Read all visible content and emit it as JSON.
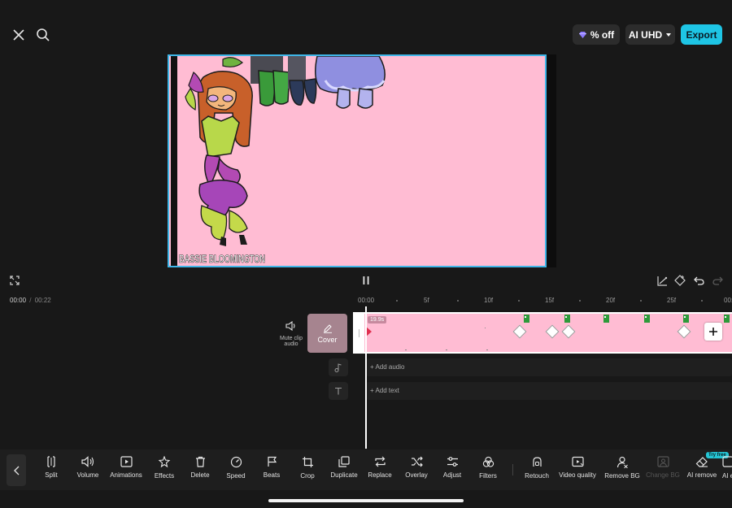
{
  "header": {
    "close_icon": "close-icon",
    "search_icon": "search-icon",
    "promo_label": "% off",
    "quality_label": "AI UHD",
    "export_label": "Export",
    "accent_color": "#1ec5e5"
  },
  "preview": {
    "watermark_text": "BASSIE BLOOMINGTON",
    "background_color": "#ffbcd3"
  },
  "playback": {
    "current_time": "00:00",
    "separator": "/",
    "total_time": "00:22"
  },
  "ruler": {
    "labels": [
      "00:00",
      "5f",
      "10f",
      "15f",
      "20f",
      "25f",
      "00:0"
    ]
  },
  "tracks": {
    "mute_label": "Mute clip audio",
    "cover_label": "Cover",
    "clip_duration": "19.9s",
    "add_audio_label": "Add audio",
    "add_text_label": "Add text"
  },
  "toolbar": {
    "items": [
      {
        "label": "Split"
      },
      {
        "label": "Volume"
      },
      {
        "label": "Animations"
      },
      {
        "label": "Effects"
      },
      {
        "label": "Delete"
      },
      {
        "label": "Speed"
      },
      {
        "label": "Beats"
      },
      {
        "label": "Crop"
      },
      {
        "label": "Duplicate"
      },
      {
        "label": "Replace"
      },
      {
        "label": "Overlay"
      },
      {
        "label": "Adjust"
      },
      {
        "label": "Filters"
      },
      {
        "label": "Retouch"
      },
      {
        "label": "Video quality"
      },
      {
        "label": "Remove BG"
      },
      {
        "label": "Change BG"
      },
      {
        "label": "AI remove"
      },
      {
        "label": "AI e"
      }
    ],
    "try_free_badge": "Try free"
  }
}
